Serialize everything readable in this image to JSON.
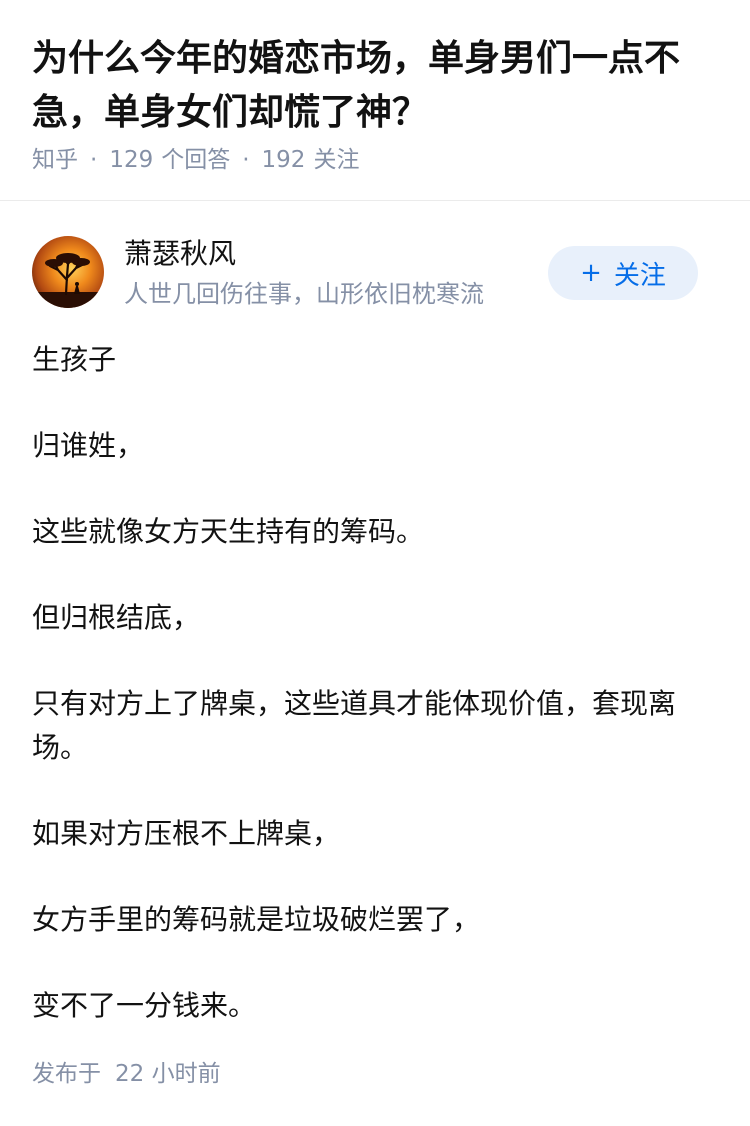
{
  "question": {
    "title": "为什么今年的婚恋市场，单身男们一点不急，单身女们却慌了神？",
    "meta": {
      "site": "知乎",
      "answers_count": "129",
      "answers_label": "个回答",
      "followers_count": "192",
      "followers_label": "关注"
    }
  },
  "author": {
    "name": "萧瑟秋风",
    "bio": "人世几回伤往事，山形依旧枕寒流",
    "avatar_icon": "sunset-tree-avatar-icon",
    "follow_button": {
      "icon": "plus-icon",
      "icon_glyph": "+",
      "label": "关注"
    }
  },
  "answer": {
    "paragraphs": [
      "生孩子",
      "归谁姓，",
      "这些就像女方天生持有的筹码。",
      "但归根结底，",
      "只有对方上了牌桌，这些道具才能体现价值，套现离场。",
      "如果对方压根不上牌桌，",
      "女方手里的筹码就是垃圾破烂罢了，",
      "变不了一分钱来。"
    ]
  },
  "footer": {
    "prefix": "发布于",
    "time": "22 小时前"
  },
  "colors": {
    "text_primary": "#121212",
    "text_secondary": "#8590a6",
    "accent": "#056de8",
    "accent_bg": "#e8f0fb",
    "divider": "#ebebeb"
  }
}
